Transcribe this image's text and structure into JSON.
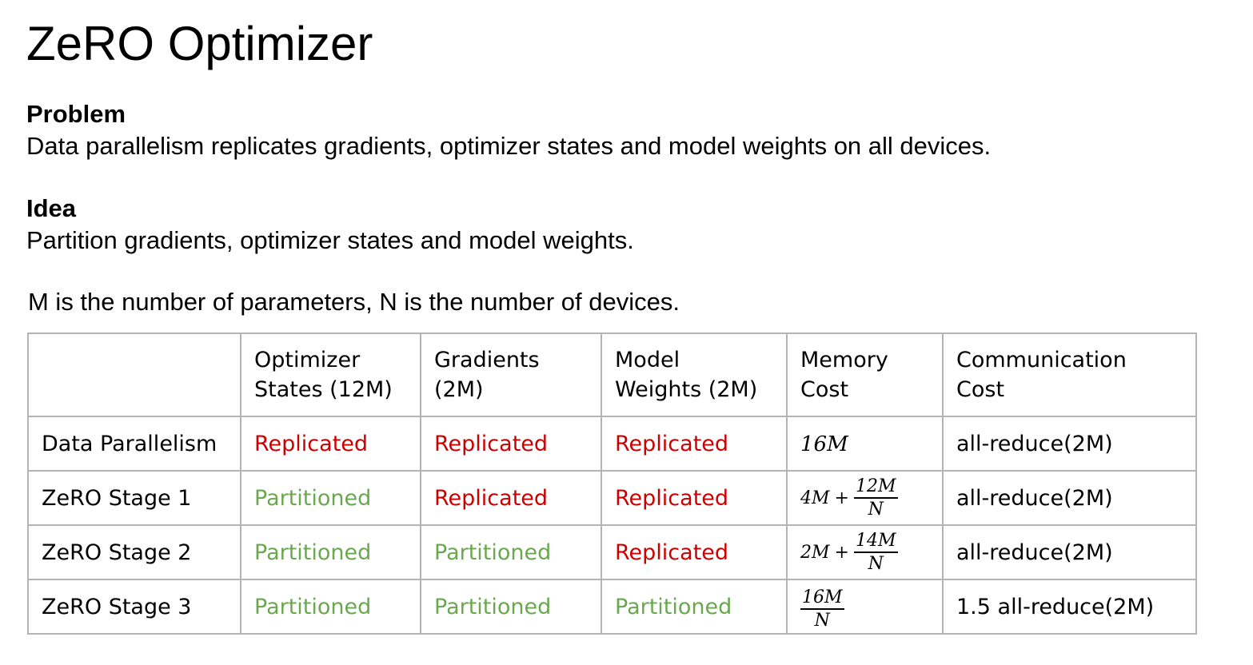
{
  "title": "ZeRO Optimizer",
  "problem": {
    "heading": "Problem",
    "text": "Data parallelism replicates gradients, optimizer states and model weights on all devices."
  },
  "idea": {
    "heading": "Idea",
    "text": "Partition gradients, optimizer states and model weights."
  },
  "note": "M is the number of parameters, N is the number of devices.",
  "colors": {
    "replicated": "#cc0000",
    "partitioned": "#6aa84f",
    "border": "#b3b3b3"
  },
  "table": {
    "headers": [
      {
        "line1": "",
        "line2": ""
      },
      {
        "line1": "Optimizer",
        "line2": "States (12M)"
      },
      {
        "line1": "Gradients",
        "line2": "(2M)"
      },
      {
        "line1": "Model",
        "line2": "Weights (2M)"
      },
      {
        "line1": "Memory",
        "line2": "Cost"
      },
      {
        "line1": "Communication",
        "line2": "Cost"
      }
    ],
    "rows": [
      {
        "name": "Data Parallelism",
        "optimizer_states": "Replicated",
        "gradients": "Replicated",
        "model_weights": "Replicated",
        "memory_cost": {
          "prefix": "",
          "plus": "",
          "numerator": "",
          "denominator": "",
          "plain": "16M"
        },
        "communication_cost": "all-reduce(2M)"
      },
      {
        "name": "ZeRO Stage 1",
        "optimizer_states": "Partitioned",
        "gradients": "Replicated",
        "model_weights": "Replicated",
        "memory_cost": {
          "prefix": "4M",
          "plus": "+",
          "numerator": "12M",
          "denominator": "N",
          "plain": ""
        },
        "communication_cost": "all-reduce(2M)"
      },
      {
        "name": "ZeRO Stage 2",
        "optimizer_states": "Partitioned",
        "gradients": "Partitioned",
        "model_weights": "Replicated",
        "memory_cost": {
          "prefix": "2M",
          "plus": "+",
          "numerator": "14M",
          "denominator": "N",
          "plain": ""
        },
        "communication_cost": "all-reduce(2M)"
      },
      {
        "name": "ZeRO Stage 3",
        "optimizer_states": "Partitioned",
        "gradients": "Partitioned",
        "model_weights": "Partitioned",
        "memory_cost": {
          "prefix": "",
          "plus": "",
          "numerator": "16M",
          "denominator": "N",
          "plain": ""
        },
        "communication_cost": "1.5 all-reduce(2M)"
      }
    ]
  }
}
